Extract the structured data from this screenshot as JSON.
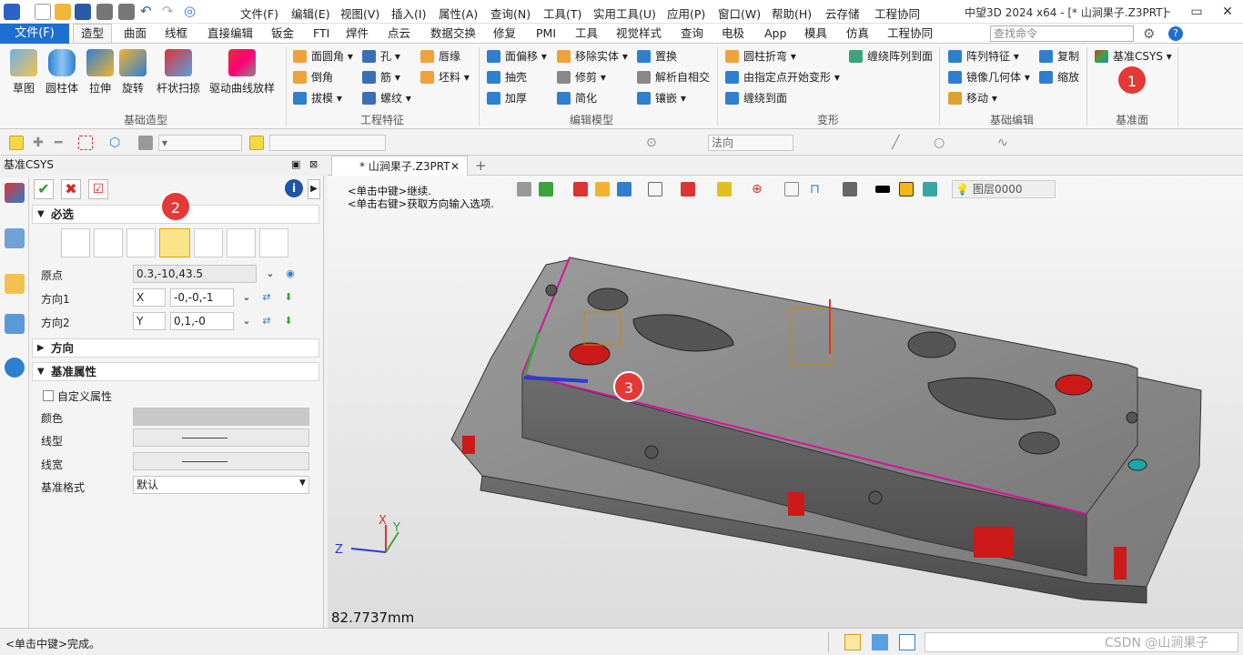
{
  "title_bar": {
    "menus": [
      "文件(F)",
      "编辑(E)",
      "视图(V)",
      "插入(I)",
      "属性(A)",
      "查询(N)",
      "工具(T)",
      "实用工具(U)",
      "应用(P)",
      "窗口(W)",
      "帮助(H)",
      "云存储",
      "工程协同"
    ],
    "window_title": "中望3D 2024 x64 - [* 山涧果子.Z3PRT]"
  },
  "tabs": {
    "file": "文件(F)",
    "items": [
      "造型",
      "曲面",
      "线框",
      "直接编辑",
      "钣金",
      "FTI",
      "焊件",
      "点云",
      "数据交换",
      "修复",
      "PMI",
      "工具",
      "视觉样式",
      "查询",
      "电极",
      "App",
      "模具",
      "仿真",
      "工程协同"
    ],
    "active": "造型",
    "search_placeholder": "查找命令"
  },
  "ribbon": {
    "basic_shape": {
      "label": "基础造型",
      "buttons": [
        "草图",
        "圆柱体",
        "拉伸",
        "旋转",
        "杆状扫掠",
        "驱动曲线放样"
      ]
    },
    "eng_feature": {
      "label": "工程特征",
      "buttons": [
        "面圆角",
        "倒角",
        "拔模",
        "孔",
        "筋",
        "螺纹",
        "唇缘",
        "坯料"
      ]
    },
    "edit_model": {
      "label": "编辑模型",
      "buttons": [
        "面偏移",
        "抽壳",
        "加厚",
        "移除实体",
        "修剪",
        "简化",
        "置换",
        "解析自相交",
        "镶嵌"
      ]
    },
    "deform": {
      "label": "变形",
      "buttons": [
        "圆柱折弯",
        "由指定点开始变形",
        "缠绕到面",
        "缠绕阵列到面"
      ]
    },
    "basic_edit": {
      "label": "基础编辑",
      "buttons": [
        "阵列特征",
        "镜像几何体",
        "移动",
        "复制",
        "缩放"
      ]
    },
    "datum": {
      "label": "基准面",
      "buttons": [
        "基准CSYS"
      ]
    }
  },
  "toolbar2": {
    "filter_value": "法向"
  },
  "panel": {
    "header": "基准CSYS",
    "required_label": "必选",
    "origin_label": "原点",
    "origin_value": "0.3,-10,43.5",
    "dir1_label": "方向1",
    "dir1_axis": "X",
    "dir1_value": "-0,-0,-1",
    "dir2_label": "方向2",
    "dir2_axis": "Y",
    "dir2_value": "0,1,-0",
    "direction_label": "方向",
    "datum_props_label": "基准属性",
    "custom_props_label": "自定义属性",
    "color_label": "颜色",
    "linetype_label": "线型",
    "linewidth_label": "线宽",
    "datum_format_label": "基准格式",
    "datum_format_value": "默认"
  },
  "viewport": {
    "doc_tab": "* 山涧果子.Z3PRT",
    "hint_1": "<单击中键>继续.",
    "hint_2": "<单击右键>获取方向输入选项.",
    "layer": "图层0000",
    "distance": "82.7737mm",
    "axis_x": "X",
    "axis_y": "Y",
    "axis_z": "Z"
  },
  "status": {
    "text": "<单击中键>完成。",
    "watermark": "CSDN @山涧果子"
  },
  "badges": [
    "1",
    "2",
    "3"
  ],
  "colors": {
    "accent": "#1e6fd1",
    "badge": "#e53935",
    "part_gray": "#8c8c8c",
    "hole_red": "#cc1a1a",
    "edge_magenta": "#d4149a"
  }
}
